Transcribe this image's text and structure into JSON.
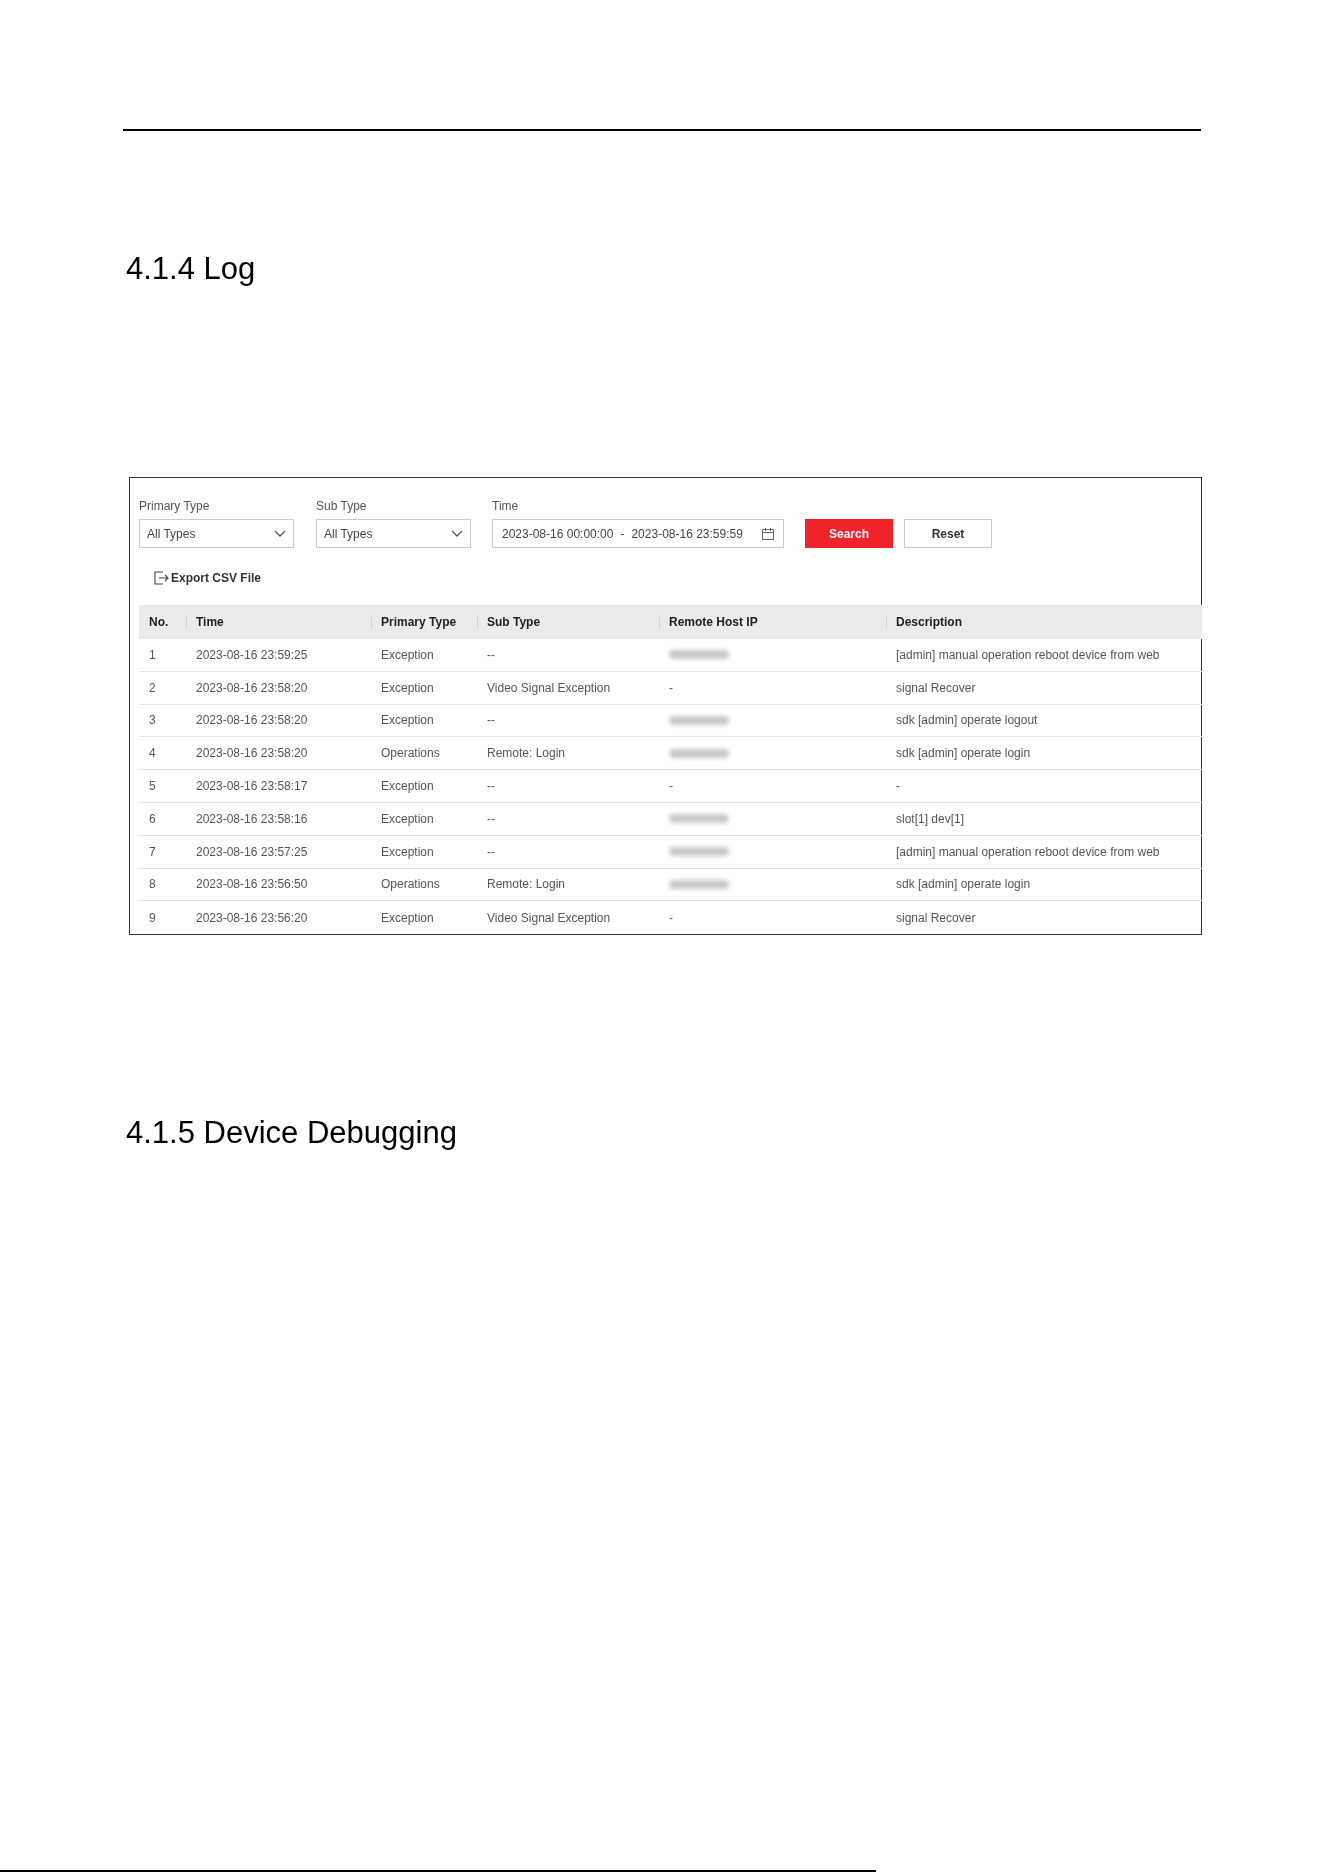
{
  "headings": [
    "4.1.4 Log",
    "4.1.5 Device Debugging"
  ],
  "filters": {
    "primary_type": {
      "label": "Primary Type",
      "value": "All Types"
    },
    "sub_type": {
      "label": "Sub Type",
      "value": "All Types"
    },
    "time": {
      "label": "Time",
      "start": "2023-08-16 00:00:00",
      "separator": "-",
      "end": "2023-08-16 23:59:59"
    },
    "buttons": [
      {
        "label": "Search",
        "kind": "primary"
      },
      {
        "label": "Reset",
        "kind": "secondary"
      }
    ]
  },
  "export": {
    "label": "Export CSV File"
  },
  "table": {
    "columns": [
      "No.",
      "Time",
      "Primary Type",
      "Sub Type",
      "Remote Host IP",
      "Description"
    ],
    "rows": [
      {
        "no": "1",
        "time": "2023-08-16 23:59:25",
        "primary_type": "Exception",
        "sub_type": "--",
        "remote_host_ip": {
          "kind": "blurred"
        },
        "description": "[admin] manual operation reboot device from web"
      },
      {
        "no": "2",
        "time": "2023-08-16 23:58:20",
        "primary_type": "Exception",
        "sub_type": "Video Signal Exception",
        "remote_host_ip": {
          "kind": "text",
          "text": "-"
        },
        "description": "signal Recover"
      },
      {
        "no": "3",
        "time": "2023-08-16 23:58:20",
        "primary_type": "Exception",
        "sub_type": "--",
        "remote_host_ip": {
          "kind": "blurred"
        },
        "description": "sdk [admin] operate logout"
      },
      {
        "no": "4",
        "time": "2023-08-16 23:58:20",
        "primary_type": "Operations",
        "sub_type": "Remote: Login",
        "remote_host_ip": {
          "kind": "blurred"
        },
        "description": "sdk [admin] operate login"
      },
      {
        "no": "5",
        "time": "2023-08-16 23:58:17",
        "primary_type": "Exception",
        "sub_type": "--",
        "remote_host_ip": {
          "kind": "text",
          "text": "-"
        },
        "description": "-"
      },
      {
        "no": "6",
        "time": "2023-08-16 23:58:16",
        "primary_type": "Exception",
        "sub_type": "--",
        "remote_host_ip": {
          "kind": "blurred"
        },
        "description": "slot[1] dev[1]"
      },
      {
        "no": "7",
        "time": "2023-08-16 23:57:25",
        "primary_type": "Exception",
        "sub_type": "--",
        "remote_host_ip": {
          "kind": "blurred"
        },
        "description": "[admin] manual operation reboot device from web"
      },
      {
        "no": "8",
        "time": "2023-08-16 23:56:50",
        "primary_type": "Operations",
        "sub_type": "Remote: Login",
        "remote_host_ip": {
          "kind": "blurred"
        },
        "description": "sdk [admin] operate login"
      },
      {
        "no": "9",
        "time": "2023-08-16 23:56:20",
        "primary_type": "Exception",
        "sub_type": "Video Signal Exception",
        "remote_host_ip": {
          "kind": "text",
          "text": "-"
        },
        "description": "signal Recover"
      }
    ]
  }
}
